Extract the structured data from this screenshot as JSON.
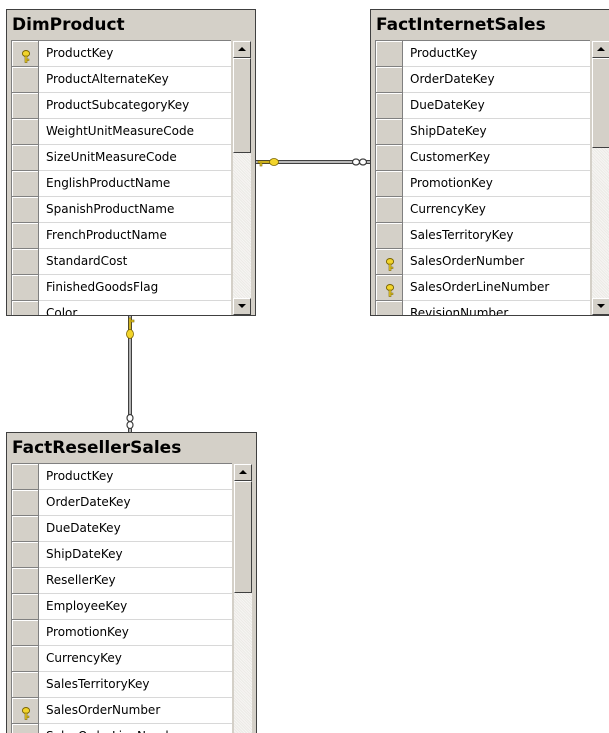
{
  "colors": {
    "table_bg": "#d4d0c8",
    "grid_bg": "#ffffff",
    "key_icon": "#f2d42b",
    "border": "#404040"
  },
  "tables": {
    "dim_product": {
      "title": "DimProduct",
      "columns": [
        {
          "name": "ProductKey",
          "primary_key": true
        },
        {
          "name": "ProductAlternateKey",
          "primary_key": false
        },
        {
          "name": "ProductSubcategoryKey",
          "primary_key": false
        },
        {
          "name": "WeightUnitMeasureCode",
          "primary_key": false
        },
        {
          "name": "SizeUnitMeasureCode",
          "primary_key": false
        },
        {
          "name": "EnglishProductName",
          "primary_key": false
        },
        {
          "name": "SpanishProductName",
          "primary_key": false
        },
        {
          "name": "FrenchProductName",
          "primary_key": false
        },
        {
          "name": "StandardCost",
          "primary_key": false
        },
        {
          "name": "FinishedGoodsFlag",
          "primary_key": false
        },
        {
          "name": "Color",
          "primary_key": false
        }
      ]
    },
    "fact_internet_sales": {
      "title": "FactInternetSales",
      "columns": [
        {
          "name": "ProductKey",
          "primary_key": false
        },
        {
          "name": "OrderDateKey",
          "primary_key": false
        },
        {
          "name": "DueDateKey",
          "primary_key": false
        },
        {
          "name": "ShipDateKey",
          "primary_key": false
        },
        {
          "name": "CustomerKey",
          "primary_key": false
        },
        {
          "name": "PromotionKey",
          "primary_key": false
        },
        {
          "name": "CurrencyKey",
          "primary_key": false
        },
        {
          "name": "SalesTerritoryKey",
          "primary_key": false
        },
        {
          "name": "SalesOrderNumber",
          "primary_key": true
        },
        {
          "name": "SalesOrderLineNumber",
          "primary_key": true
        },
        {
          "name": "RevisionNumber",
          "primary_key": false
        }
      ]
    },
    "fact_reseller_sales": {
      "title": "FactResellerSales",
      "columns": [
        {
          "name": "ProductKey",
          "primary_key": false
        },
        {
          "name": "OrderDateKey",
          "primary_key": false
        },
        {
          "name": "DueDateKey",
          "primary_key": false
        },
        {
          "name": "ShipDateKey",
          "primary_key": false
        },
        {
          "name": "ResellerKey",
          "primary_key": false
        },
        {
          "name": "EmployeeKey",
          "primary_key": false
        },
        {
          "name": "PromotionKey",
          "primary_key": false
        },
        {
          "name": "CurrencyKey",
          "primary_key": false
        },
        {
          "name": "SalesTerritoryKey",
          "primary_key": false
        },
        {
          "name": "SalesOrderNumber",
          "primary_key": true
        },
        {
          "name": "SalesOrderLineNumber",
          "primary_key": true
        }
      ]
    }
  },
  "relationships": [
    {
      "from": "DimProduct",
      "to": "FactInternetSales",
      "from_end": "one-key-icon",
      "to_end": "many-infinity-icon"
    },
    {
      "from": "DimProduct",
      "to": "FactResellerSales",
      "from_end": "one-key-icon",
      "to_end": "many-infinity-icon"
    }
  ]
}
